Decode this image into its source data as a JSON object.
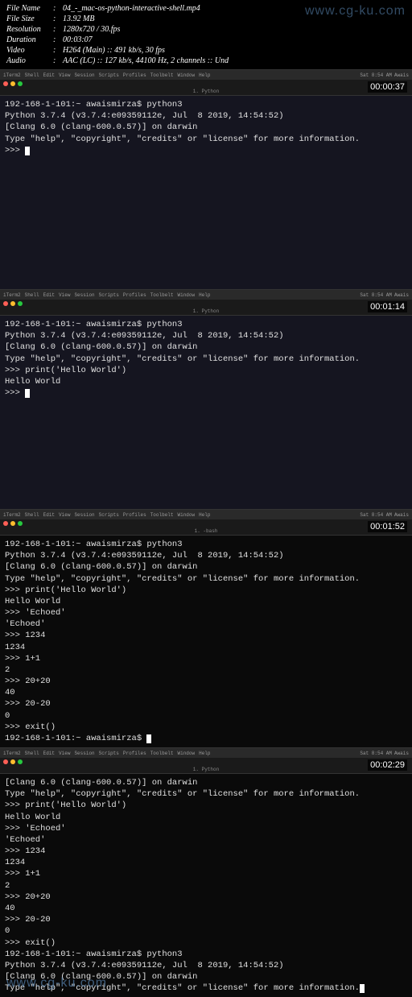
{
  "metadata": {
    "filename_label": "File Name",
    "filename": "04_-_mac-os-python-interactive-shell.mp4",
    "filesize_label": "File Size",
    "filesize": "13.92 MB",
    "resolution_label": "Resolution",
    "resolution": "1280x720 / 30.fps",
    "duration_label": "Duration",
    "duration": "00:03:07",
    "video_label": "Video",
    "video": "H264 (Main) :: 491 kb/s, 30 fps",
    "audio_label": "Audio",
    "audio": "AAC (LC) :: 127 kb/s, 44100 Hz, 2 channels :: Und"
  },
  "watermark": "www.cg-ku.com",
  "menubar": {
    "app": "iTerm2",
    "items": [
      "Shell",
      "Edit",
      "View",
      "Session",
      "Scripts",
      "Profiles",
      "Toolbelt",
      "Window",
      "Help"
    ],
    "time": "Sat 8:54 AM",
    "user": "Awais"
  },
  "tab_title": "1. Python",
  "tab_title_bash": "1. -bash",
  "frames": [
    {
      "timestamp": "00:00:37",
      "lines": [
        "192-168-1-101:~ awaismirza$ python3",
        "Python 3.7.4 (v3.7.4:e09359112e, Jul  8 2019, 14:54:52)",
        "[Clang 6.0 (clang-600.0.57)] on darwin",
        "Type \"help\", \"copyright\", \"credits\" or \"license\" for more information.",
        ">>> "
      ],
      "cursor": true
    },
    {
      "timestamp": "00:01:14",
      "lines": [
        "192-168-1-101:~ awaismirza$ python3",
        "Python 3.7.4 (v3.7.4:e09359112e, Jul  8 2019, 14:54:52)",
        "[Clang 6.0 (clang-600.0.57)] on darwin",
        "Type \"help\", \"copyright\", \"credits\" or \"license\" for more information.",
        ">>> print('Hello World')",
        "Hello World",
        ">>> "
      ],
      "cursor": true
    },
    {
      "timestamp": "00:01:52",
      "lines": [
        "192-168-1-101:~ awaismirza$ python3",
        "Python 3.7.4 (v3.7.4:e09359112e, Jul  8 2019, 14:54:52)",
        "[Clang 6.0 (clang-600.0.57)] on darwin",
        "Type \"help\", \"copyright\", \"credits\" or \"license\" for more information.",
        ">>> print('Hello World')",
        "Hello World",
        ">>> 'Echoed'",
        "'Echoed'",
        ">>> 1234",
        "1234",
        ">>> 1+1",
        "2",
        ">>> 20+20",
        "40",
        ">>> 20-20",
        "0",
        ">>> exit()",
        "192-168-1-101:~ awaismirza$ "
      ],
      "cursor": true
    },
    {
      "timestamp": "00:02:29",
      "lines": [
        "[Clang 6.0 (clang-600.0.57)] on darwin",
        "Type \"help\", \"copyright\", \"credits\" or \"license\" for more information.",
        ">>> print('Hello World')",
        "Hello World",
        ">>> 'Echoed'",
        "'Echoed'",
        ">>> 1234",
        "1234",
        ">>> 1+1",
        "2",
        ">>> 20+20",
        "40",
        ">>> 20-20",
        "0",
        ">>> exit()",
        "192-168-1-101:~ awaismirza$ python3",
        "Python 3.7.4 (v3.7.4:e09359112e, Jul  8 2019, 14:54:52)",
        "[Clang 6.0 (clang-600.0.57)] on darwin",
        "Type \"help\", \"copyright\", \"credits\" or \"license\" for more information.",
        ">>> "
      ],
      "cursor": true
    }
  ]
}
